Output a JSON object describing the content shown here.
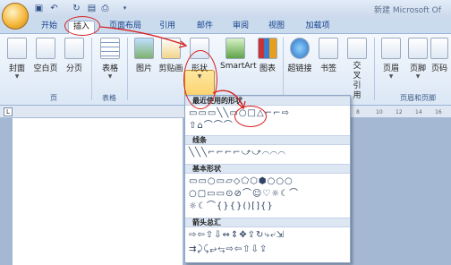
{
  "app": {
    "title": "新建 Microsoft Of"
  },
  "tabs": [
    {
      "label": "开始"
    },
    {
      "label": "插入"
    },
    {
      "label": "页面布局"
    },
    {
      "label": "引用"
    },
    {
      "label": "邮件"
    },
    {
      "label": "审阅"
    },
    {
      "label": "视图"
    },
    {
      "label": "加载项"
    }
  ],
  "ribbon": {
    "buttons": [
      {
        "label": "封面"
      },
      {
        "label": "空白页"
      },
      {
        "label": "分页"
      },
      {
        "label": "表格"
      },
      {
        "label": "图片"
      },
      {
        "label": "剪贴画"
      },
      {
        "label": "形状"
      },
      {
        "label": "SmartArt"
      },
      {
        "label": "图表"
      },
      {
        "label": "超链接"
      },
      {
        "label": "书签"
      },
      {
        "label": "交叉引用"
      },
      {
        "label": "页眉"
      },
      {
        "label": "页脚"
      },
      {
        "label": "页码"
      }
    ],
    "groups": [
      {
        "label": "页"
      },
      {
        "label": "表格"
      },
      {
        "label": "页眉和页脚"
      }
    ]
  },
  "ruler": {
    "marks": [
      "8",
      "10",
      "12",
      "14",
      "16"
    ]
  },
  "shapes_gallery": {
    "sections": [
      {
        "title": "最近使用的形状",
        "rows": [
          "▭▭▭╲╲▭○□△⌐⌐⇨",
          "⇧⌂⌒⌒⌒"
        ]
      },
      {
        "title": "线条",
        "rows": [
          "╲╲╲⌐⌐⌐⌐⤻⤻⌒⌒⌒"
        ]
      },
      {
        "title": "基本形状",
        "rows": [
          "▭▭○▭▱◇⬠⬡⬢○○○",
          "○▢▭▭⊙⊘⌒☺♡☼☾⌒",
          "☼☾⌒{}{}()[]{}"
        ]
      },
      {
        "title": "箭头总汇",
        "rows": [
          "⇨⇦⇧⇩⇔⇕✥⇪↻⤷⤶⇲",
          "⇉⤸⤹⥂⥃⇨⇦⇧⇩⇪"
        ]
      }
    ]
  },
  "annotation": {
    "color": "#d72020"
  }
}
